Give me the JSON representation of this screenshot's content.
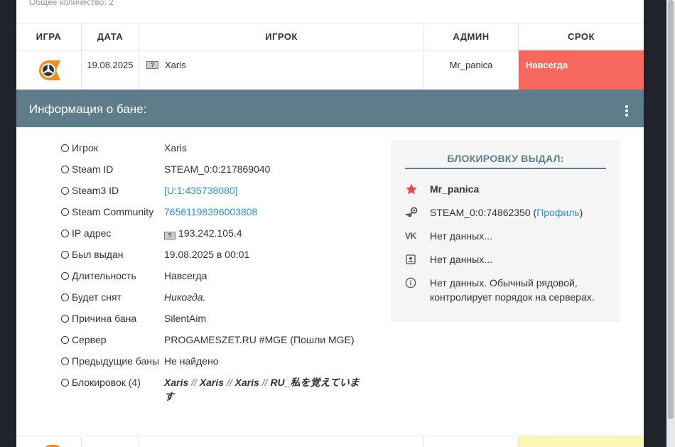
{
  "summary": {
    "total": "Общее количество: 2"
  },
  "table": {
    "headers": [
      "ИГРА",
      "ДАТА",
      "ИГРОК",
      "АДМИН",
      "СРОК"
    ],
    "row": {
      "date": "19.08.2025",
      "flag": "?",
      "player": "Xaris",
      "admin": "Mr_panica",
      "term": "Навсегда",
      "term_color": "#f6685e"
    }
  },
  "info": {
    "title": "Информация о бане:",
    "bar_color": "#5f7c8a",
    "rows": [
      {
        "label": "Игрок",
        "value": "Xaris"
      },
      {
        "label": "Steam ID",
        "value": "STEAM_0:0:217869040"
      },
      {
        "label": "Steam3 ID",
        "value": "[U:1:435738080]"
      },
      {
        "label": "Steam Community",
        "value": "76561198396003808"
      },
      {
        "label": "IP адрес",
        "value": "193.242.105.4"
      },
      {
        "label": "Был выдан",
        "value": "19.08.2025 в 00:01"
      },
      {
        "label": "Длительность",
        "value": "Навсегда"
      },
      {
        "label": "Будет снят",
        "value": "Никогда."
      },
      {
        "label": "Причина бана",
        "value": "SilentAim"
      },
      {
        "label": "Сервер",
        "value": "PROGAMESZET.RU #MGE (Пошли MGE)"
      },
      {
        "label": "Предыдущие баны",
        "value": "Не найдено"
      },
      {
        "label": "Блокировок (4)",
        "names": [
          "Xaris",
          "Xaris",
          "Xaris",
          "RU_私を覚えています"
        ],
        "separator": "//"
      }
    ]
  },
  "admin_box": {
    "title": "БЛОКИРОВКУ ВЫДАЛ:",
    "name": "Mr_panica",
    "steam": "STEAM_0:0:74862350",
    "profile_link": "Профиль",
    "vk": "Нет данных...",
    "contact": "Нет данных...",
    "about": "Нет данных. Обычный рядовой, контролирует порядок на серверах."
  },
  "icons": [
    "game-icon",
    "flag-icon",
    "more-vert-icon",
    "star-icon",
    "steam-icon",
    "vk-icon",
    "contact-icon",
    "info-icon"
  ],
  "colors": {
    "accent": "#5f7c8a",
    "link": "#2f90d8",
    "star": "#e74c3c",
    "term_next": "#fdf7b5"
  }
}
